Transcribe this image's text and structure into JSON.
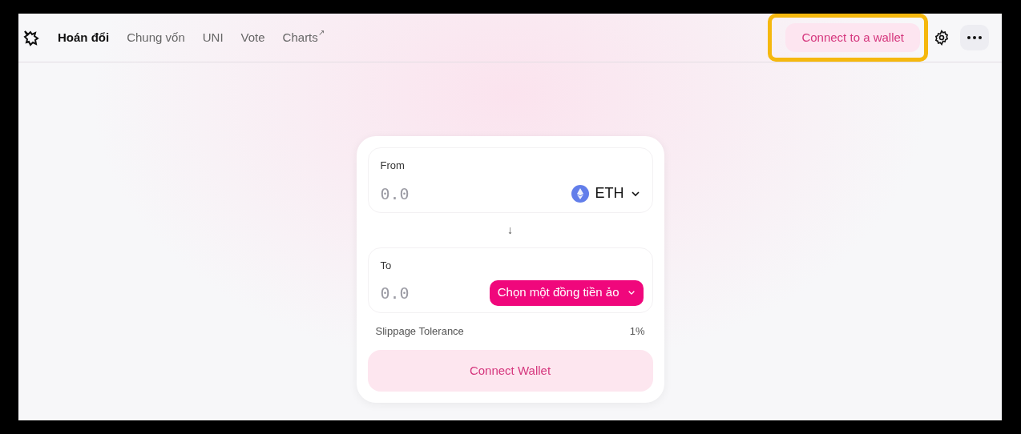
{
  "nav": {
    "items": [
      {
        "label": "Hoán đổi",
        "selected": true
      },
      {
        "label": "Chung vốn",
        "selected": false
      },
      {
        "label": "UNI",
        "selected": false
      },
      {
        "label": "Vote",
        "selected": false
      },
      {
        "label": "Charts",
        "selected": false,
        "external_mark": "↗"
      }
    ]
  },
  "wallet_button": {
    "label": "Connect to a wallet",
    "highlighted": true
  },
  "swap": {
    "from": {
      "label": "From",
      "placeholder": "0.0",
      "token": "ETH"
    },
    "arrow": "↓",
    "to": {
      "label": "To",
      "placeholder": "0.0",
      "token_button": "Chọn một đồng tiền ảo"
    },
    "slippage": {
      "label": "Slippage Tolerance",
      "value": "1%"
    },
    "connect_button": "Connect Wallet"
  }
}
